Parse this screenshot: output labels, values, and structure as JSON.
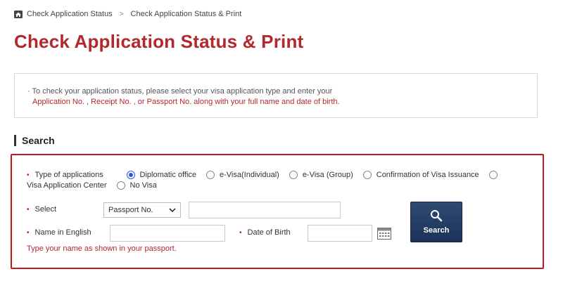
{
  "breadcrumb": {
    "home_icon": "home-icon",
    "item1": "Check Application Status",
    "separator": ">",
    "item2": "Check Application Status & Print"
  },
  "page_title": "Check Application Status & Print",
  "notice": {
    "line1": "· To check your application status, please select your visa application type and enter your",
    "line2": "Application No. , Receipt No. , or Passport No. along with your full name and date of birth."
  },
  "section_title": "Search",
  "form": {
    "required_mark": "•",
    "type_label": "Type of applications",
    "options": [
      {
        "label": "Diplomatic office",
        "checked": true
      },
      {
        "label": "e-Visa(Individual)",
        "checked": false
      },
      {
        "label": "e-Visa (Group)",
        "checked": false
      },
      {
        "label": "Confirmation of Visa Issuance",
        "checked": false
      },
      {
        "label": "Visa Application Center",
        "checked": false
      },
      {
        "label": "No Visa",
        "checked": false
      }
    ],
    "select_label": "Select",
    "select_value": "Passport No.",
    "select_input_value": "",
    "name_label": "Name in English",
    "name_value": "",
    "dob_label": "Date of Birth",
    "dob_value": "",
    "search_button": "Search",
    "hint": "Type your name as shown in your passport."
  },
  "colors": {
    "title_red": "#b3282d",
    "border_red": "#c4171d",
    "button_navy": "#243d63",
    "radio_blue": "#2a5bd7"
  }
}
